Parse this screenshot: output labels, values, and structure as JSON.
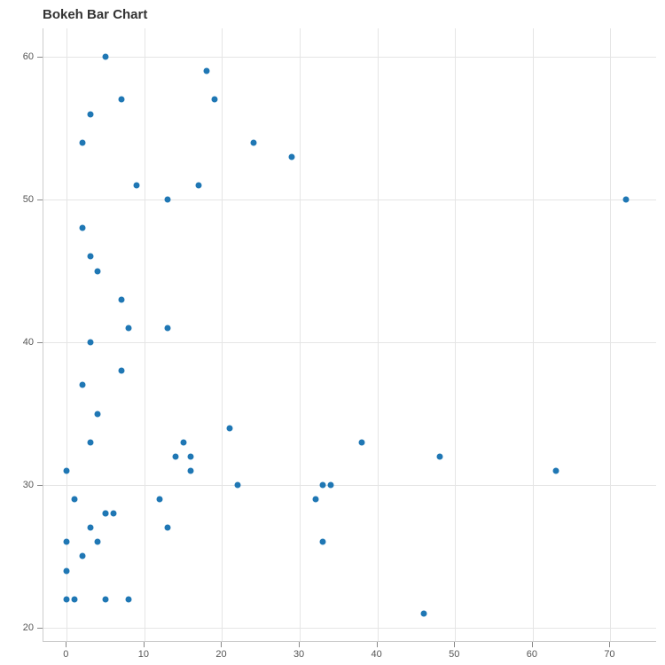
{
  "chart_data": {
    "type": "scatter",
    "title": "Bokeh Bar Chart",
    "xlabel": "",
    "ylabel": "",
    "xlim": [
      -3,
      76
    ],
    "ylim": [
      19,
      62
    ],
    "x_ticks": [
      0,
      10,
      20,
      30,
      40,
      50,
      60,
      70
    ],
    "y_ticks": [
      20,
      30,
      40,
      50,
      60
    ],
    "x": [
      0,
      0,
      0,
      0,
      1,
      1,
      2,
      2,
      2,
      2,
      3,
      3,
      3,
      3,
      3,
      4,
      4,
      4,
      5,
      5,
      5,
      5,
      6,
      7,
      7,
      7,
      8,
      8,
      9,
      12,
      13,
      13,
      13,
      14,
      15,
      16,
      16,
      17,
      18,
      19,
      21,
      22,
      24,
      29,
      32,
      33,
      33,
      34,
      38,
      46,
      48,
      63,
      72
    ],
    "y": [
      22,
      24,
      26,
      31,
      22,
      29,
      25,
      37,
      48,
      54,
      27,
      33,
      40,
      46,
      56,
      26,
      35,
      45,
      22,
      28,
      28,
      60,
      28,
      38,
      43,
      57,
      22,
      41,
      51,
      29,
      27,
      41,
      50,
      32,
      33,
      31,
      32,
      51,
      59,
      57,
      34,
      30,
      54,
      53,
      29,
      26,
      30,
      30,
      33,
      21,
      32,
      31,
      50
    ]
  }
}
